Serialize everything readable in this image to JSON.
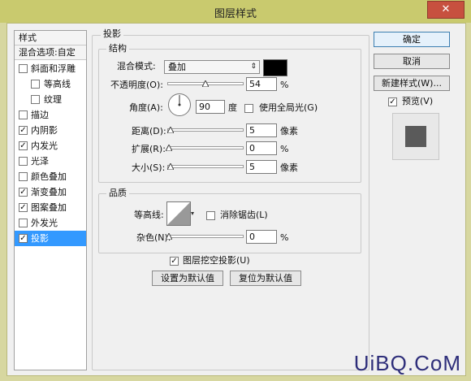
{
  "window": {
    "title": "图层样式",
    "close_label": "✕"
  },
  "sidebar": {
    "header_styles": "样式",
    "header_blend": "混合选项:自定",
    "items": [
      {
        "label": "斜面和浮雕",
        "checked": false
      },
      {
        "label": "等高线",
        "checked": false
      },
      {
        "label": "纹理",
        "checked": false
      },
      {
        "label": "描边",
        "checked": false
      },
      {
        "label": "内阴影",
        "checked": true
      },
      {
        "label": "内发光",
        "checked": true
      },
      {
        "label": "光泽",
        "checked": false
      },
      {
        "label": "颜色叠加",
        "checked": false
      },
      {
        "label": "渐变叠加",
        "checked": true
      },
      {
        "label": "图案叠加",
        "checked": true
      },
      {
        "label": "外发光",
        "checked": false
      },
      {
        "label": "投影",
        "checked": true,
        "selected": true
      }
    ]
  },
  "section": {
    "title": "投影",
    "structure": {
      "legend": "结构",
      "blend_mode_label": "混合模式:",
      "blend_mode_value": "叠加",
      "blend_color": "#000000",
      "opacity_label": "不透明度(O):",
      "opacity_value": "54",
      "opacity_unit": "%",
      "angle_label": "角度(A):",
      "angle_value": "90",
      "angle_unit": "度",
      "global_light_label": "使用全局光(G)",
      "distance_label": "距离(D):",
      "distance_value": "5",
      "distance_unit": "像素",
      "spread_label": "扩展(R):",
      "spread_value": "0",
      "spread_unit": "%",
      "size_label": "大小(S):",
      "size_value": "5",
      "size_unit": "像素"
    },
    "quality": {
      "legend": "品质",
      "contour_label": "等高线:",
      "anti_alias_label": "消除锯齿(L)",
      "noise_label": "杂色(N):",
      "noise_value": "0",
      "noise_unit": "%"
    },
    "knockout_label": "图层挖空投影(U)",
    "make_default_label": "设置为默认值",
    "reset_default_label": "复位为默认值"
  },
  "buttons": {
    "ok": "确定",
    "cancel": "取消",
    "new_style": "新建样式(W)...",
    "preview_label": "预览(V)"
  },
  "watermark": "UiBQ.CoM"
}
